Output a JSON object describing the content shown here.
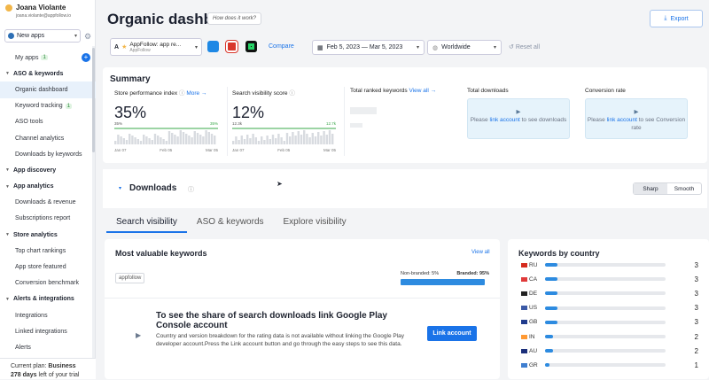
{
  "user": {
    "name": "Joana Violante",
    "email": "joana.violante@appfollow.io"
  },
  "app_selector": {
    "label": "New apps"
  },
  "nav": [
    {
      "label": "My apps",
      "type": "sub",
      "badge": "1",
      "plus": true
    },
    {
      "label": "ASO & keywords",
      "type": "sec"
    },
    {
      "label": "Organic dashboard",
      "type": "sub",
      "active": true
    },
    {
      "label": "Keyword tracking",
      "type": "sub",
      "badge": "1"
    },
    {
      "label": "ASO tools",
      "type": "sub"
    },
    {
      "label": "Channel analytics",
      "type": "sub"
    },
    {
      "label": "Downloads by keywords",
      "type": "sub"
    },
    {
      "label": "App discovery",
      "type": "sec"
    },
    {
      "label": "App analytics",
      "type": "sec"
    },
    {
      "label": "Downloads & revenue",
      "type": "sub"
    },
    {
      "label": "Subscriptions report",
      "type": "sub"
    },
    {
      "label": "Store analytics",
      "type": "sec"
    },
    {
      "label": "Top chart rankings",
      "type": "sub"
    },
    {
      "label": "App store featured",
      "type": "sub"
    },
    {
      "label": "Conversion benchmark",
      "type": "sub"
    },
    {
      "label": "Alerts & integrations",
      "type": "sec"
    },
    {
      "label": "Integrations",
      "type": "sub"
    },
    {
      "label": "Linked integrations",
      "type": "sub"
    },
    {
      "label": "Alerts",
      "type": "sub"
    }
  ],
  "plan": {
    "line1_prefix": "Current plan: ",
    "plan_name": "Business",
    "days": "278 days",
    "line2_suffix": " left of your trial"
  },
  "header": {
    "title": "Organic dashboard",
    "how": "How does it work?",
    "export": "Export"
  },
  "filters": {
    "app_name": "AppFollow: app re...",
    "app_dev": "AppFollow",
    "compare": "Compare",
    "date_range": "Feb 5, 2023 — Mar 5, 2023",
    "region": "Worldwide",
    "reset": "Reset all"
  },
  "summary": {
    "title": "Summary",
    "store_perf": {
      "label": "Store performance index",
      "more": "More →",
      "value": "35%",
      "mini": "35%",
      "mini_end": "35%",
      "axis": [
        "Jan 07",
        "Feb 05",
        "Mar 05"
      ]
    },
    "visibility": {
      "label": "Search visibility score",
      "value": "12%",
      "mini": "12.3k",
      "mini_end": "12.7k",
      "axis": [
        "Jan 07",
        "Feb 05",
        "Mar 05"
      ]
    },
    "ranked": {
      "label": "Total ranked keywords",
      "viewall": "View all →"
    },
    "downloads": {
      "label": "Total downloads",
      "text1": "Please ",
      "link": "link account",
      "text2": " to see downloads"
    },
    "conversion": {
      "label": "Conversion rate",
      "text1": "Please ",
      "link": "link account",
      "text2": " to see Conversion rate"
    }
  },
  "downloads_section": {
    "title": "Downloads",
    "toggle": [
      "Sharp",
      "Smooth"
    ]
  },
  "tabs": [
    "Search visibility",
    "ASO & keywords",
    "Explore visibility"
  ],
  "mvk": {
    "title": "Most valuable keywords",
    "viewall": "View all",
    "tag": "appfollow",
    "nonbranded": "Non-branded: 5%",
    "branded": "Branded: 95%",
    "branded_share": 0.95
  },
  "notice": {
    "heading": "To see the share of search downloads link Google Play Console account",
    "body": "Country and version breakdown for the rating data is not available without linking the Google Play developer account.Press the Link account button and go through the easy steps to see this data.",
    "button": "Link account"
  },
  "kbc": {
    "title": "Keywords by country",
    "rows": [
      {
        "code": "RU",
        "value": "3",
        "n": 3,
        "color": "#d52b1e"
      },
      {
        "code": "CA",
        "value": "3",
        "n": 3,
        "color": "#e03a3a"
      },
      {
        "code": "DE",
        "value": "3",
        "n": 3,
        "color": "#222222"
      },
      {
        "code": "US",
        "value": "3",
        "n": 3,
        "color": "#3c5aa6"
      },
      {
        "code": "GB",
        "value": "3",
        "n": 3,
        "color": "#1f3b8c"
      },
      {
        "code": "IN",
        "value": "2",
        "n": 2,
        "color": "#ff9933"
      },
      {
        "code": "AU",
        "value": "2",
        "n": 2,
        "color": "#1b2f7a"
      },
      {
        "code": "GR",
        "value": "1",
        "n": 1,
        "color": "#3f7fd0"
      }
    ]
  }
}
